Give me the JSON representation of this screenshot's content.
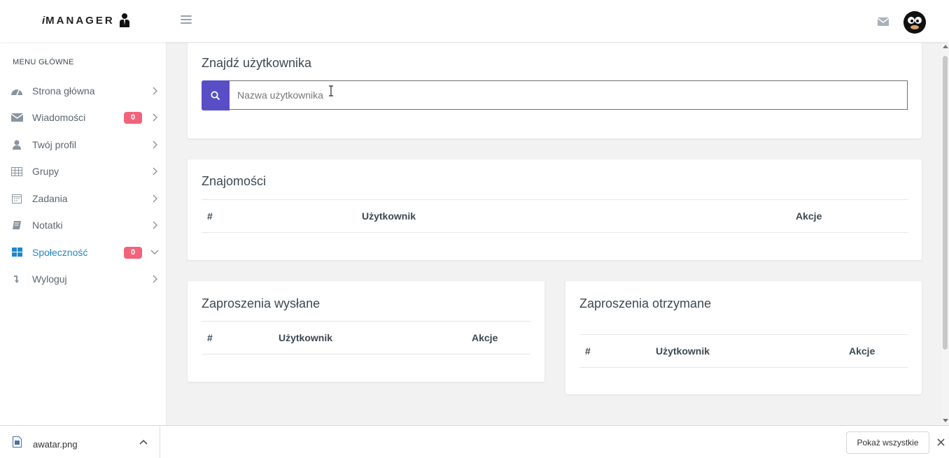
{
  "brand": {
    "logo_text_prefix": "i",
    "logo_text": "MANAGER"
  },
  "sidebar": {
    "menu_title": "MENU GŁÓWNE",
    "items": [
      {
        "label": "Strona główna",
        "icon": "dashboard-icon",
        "badge": null,
        "active": false
      },
      {
        "label": "Wiadomości",
        "icon": "envelope-icon",
        "badge": "0",
        "active": false
      },
      {
        "label": "Twój profil",
        "icon": "user-icon",
        "badge": null,
        "active": false
      },
      {
        "label": "Grupy",
        "icon": "table-icon",
        "badge": null,
        "active": false
      },
      {
        "label": "Zadania",
        "icon": "calendar-icon",
        "badge": null,
        "active": false
      },
      {
        "label": "Notatki",
        "icon": "book-icon",
        "badge": null,
        "active": false
      },
      {
        "label": "Społeczność",
        "icon": "grid-icon",
        "badge": "0",
        "active": true
      },
      {
        "label": "Wyloguj",
        "icon": "logout-arrow-icon",
        "badge": null,
        "active": false
      }
    ]
  },
  "find_user": {
    "title": "Znajdź użytkownika",
    "search_placeholder": "Nazwa użytkownika",
    "search_value": ""
  },
  "friends": {
    "title": "Znajomości",
    "columns": [
      "#",
      "Użytkownik",
      "Akcje"
    ],
    "rows": []
  },
  "sent_invites": {
    "title": "Zaproszenia wysłane",
    "columns": [
      "#",
      "Użytkownik",
      "Akcje"
    ],
    "rows": []
  },
  "received_invites": {
    "title": "Zaproszenia otrzymane",
    "columns": [
      "#",
      "Użytkownik",
      "Akcje"
    ],
    "rows": []
  },
  "download_bar": {
    "file_name": "awatar.png",
    "show_all_label": "Pokaż wszystkie"
  },
  "colors": {
    "accent": "#5a4ec7",
    "badge": "#f2637b",
    "active_link": "#1e88c7"
  }
}
